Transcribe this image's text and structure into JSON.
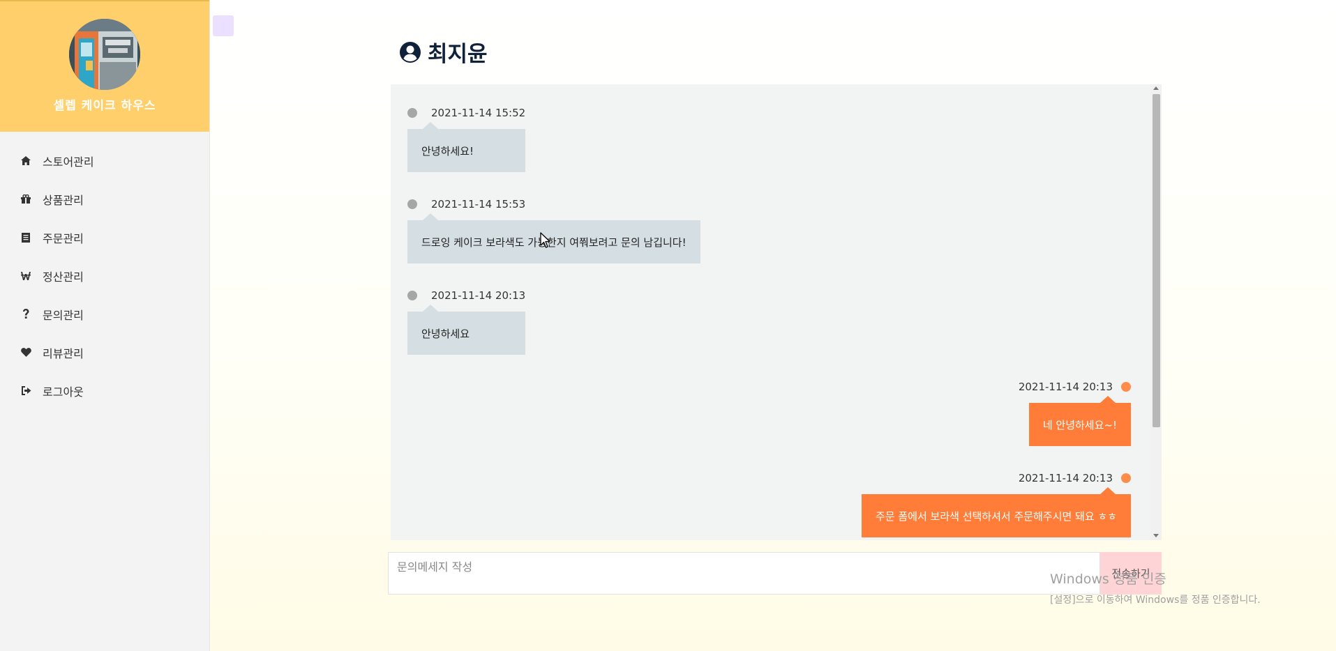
{
  "sidebar": {
    "shop_name": "셀렙 케이크 하우스",
    "items": [
      {
        "label": "스토어관리",
        "icon": "home-icon"
      },
      {
        "label": "상품관리",
        "icon": "gift-icon"
      },
      {
        "label": "주문관리",
        "icon": "document-icon"
      },
      {
        "label": "정산관리",
        "icon": "won-icon"
      },
      {
        "label": "문의관리",
        "icon": "question-icon"
      },
      {
        "label": "리뷰관리",
        "icon": "heart-icon"
      },
      {
        "label": "로그아웃",
        "icon": "logout-icon"
      }
    ]
  },
  "chat": {
    "title": "최지윤",
    "title_icon": "user-circle-icon",
    "messages": [
      {
        "side": "left",
        "time": "2021-11-14 15:52",
        "text": "안녕하세요!"
      },
      {
        "side": "left",
        "time": "2021-11-14 15:53",
        "text": "드로잉 케이크 보라색도 가능한지 여쭤보려고 문의 남깁니다!"
      },
      {
        "side": "left",
        "time": "2021-11-14 20:13",
        "text": "안녕하세요"
      },
      {
        "side": "right",
        "time": "2021-11-14 20:13",
        "text": "네 안녕하세요~!"
      },
      {
        "side": "right",
        "time": "2021-11-14 20:13",
        "text": "주문 폼에서 보라색 선택하셔서 주문해주시면 돼요 ㅎㅎ"
      }
    ],
    "input_placeholder": "문의메세지 작성",
    "send_label": "전송하기"
  },
  "watermark": {
    "title": "Windows 정품 인증",
    "subtitle": "[설정]으로 이동하여 Windows를 정품 인증합니다."
  },
  "colors": {
    "brand": "#ffcf6b",
    "incoming_bubble": "#d5dee3",
    "outgoing_bubble": "#ff7d38",
    "send_button": "#ffd4d6"
  }
}
